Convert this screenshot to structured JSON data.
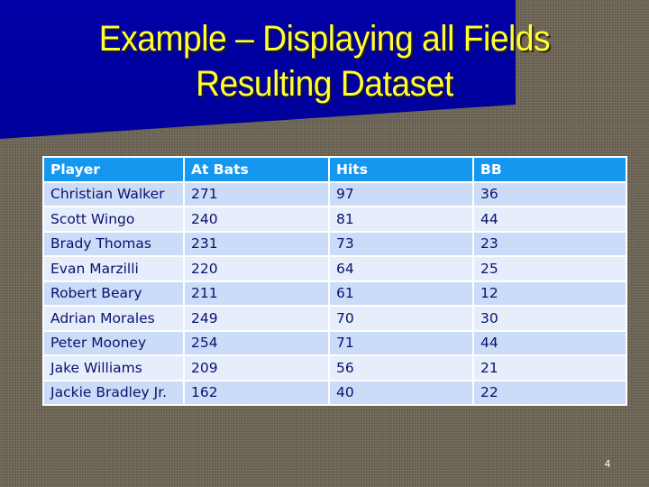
{
  "slide": {
    "title_line1": "Example – Displaying all Fields",
    "title_line2": "Resulting Dataset",
    "page_number": "4",
    "colors": {
      "background": "#6d6555",
      "title_band": "#0000a8",
      "title_text": "#ffff33",
      "header_bg": "#1597f0",
      "header_text": "#ffffff",
      "row_odd_bg": "#cbdcf8",
      "row_even_bg": "#e6eefc",
      "cell_text": "#0d0f70"
    }
  },
  "table": {
    "columns": [
      "Player",
      "At Bats",
      "Hits",
      "BB"
    ],
    "rows": [
      [
        "Christian Walker",
        "271",
        "97",
        "36"
      ],
      [
        "Scott Wingo",
        "240",
        "81",
        "44"
      ],
      [
        "Brady Thomas",
        "231",
        "73",
        "23"
      ],
      [
        "Evan Marzilli",
        "220",
        "64",
        "25"
      ],
      [
        "Robert Beary",
        "211",
        "61",
        "12"
      ],
      [
        "Adrian Morales",
        "249",
        "70",
        "30"
      ],
      [
        "Peter Mooney",
        "254",
        "71",
        "44"
      ],
      [
        "Jake Williams",
        "209",
        "56",
        "21"
      ],
      [
        "Jackie Bradley Jr.",
        "162",
        "40",
        "22"
      ]
    ]
  }
}
